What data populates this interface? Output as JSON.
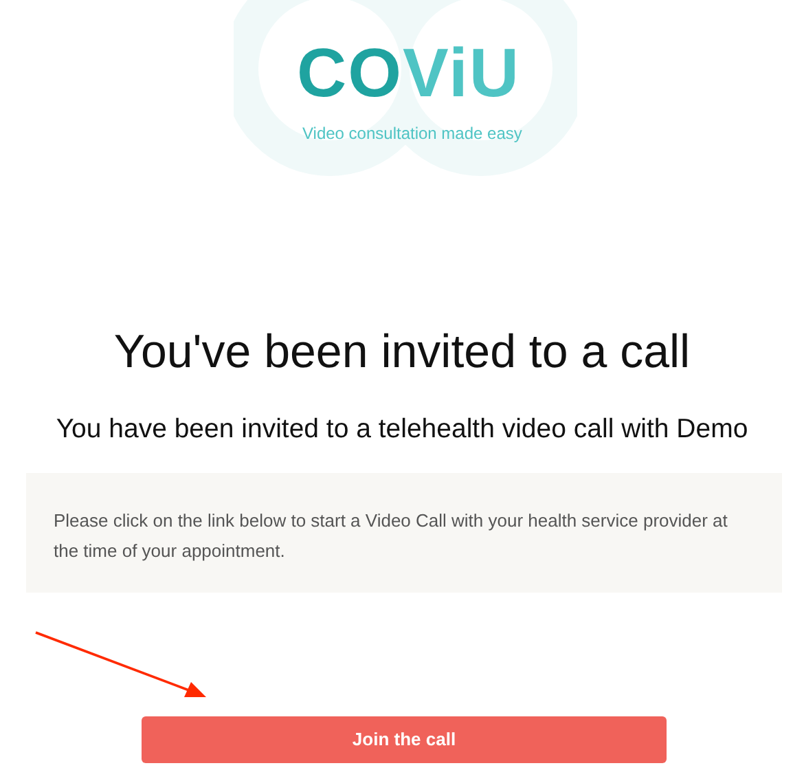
{
  "logo": {
    "parts": [
      {
        "text": "CO",
        "color": "#1fa3a0"
      },
      {
        "text": "ViU",
        "color": "#4fc4c4"
      }
    ],
    "tagline": "Video consultation made easy"
  },
  "heading": "You've been invited to a call",
  "subheading": "You have been invited to a telehealth video call with Demo",
  "message": "Please click on the link below to start a Video Call with your health service provider at the time of your appointment.",
  "button": "Join the call"
}
